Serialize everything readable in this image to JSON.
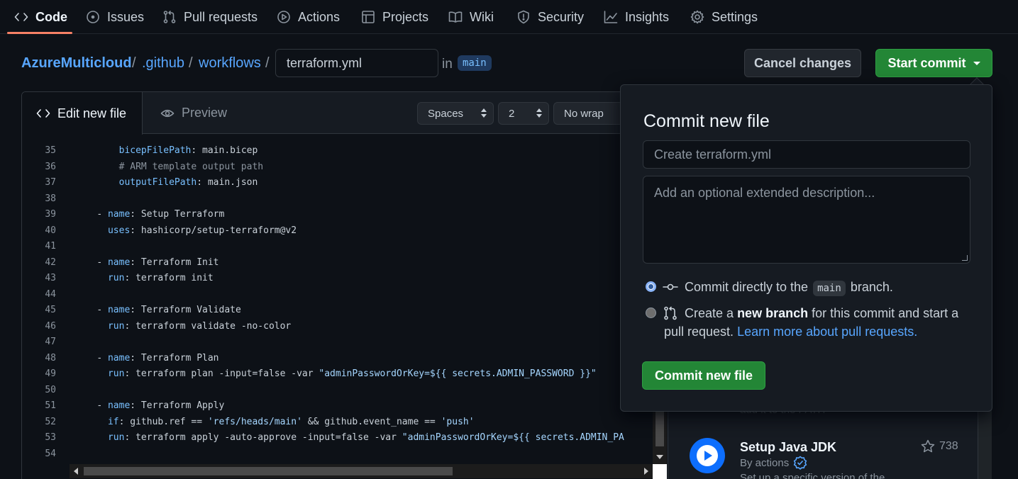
{
  "nav": {
    "tabs": [
      {
        "label": "Code",
        "icon": "code-icon"
      },
      {
        "label": "Issues",
        "icon": "issue-icon"
      },
      {
        "label": "Pull requests",
        "icon": "pull-request-icon"
      },
      {
        "label": "Actions",
        "icon": "play-icon"
      },
      {
        "label": "Projects",
        "icon": "table-icon"
      },
      {
        "label": "Wiki",
        "icon": "book-icon"
      },
      {
        "label": "Security",
        "icon": "shield-icon"
      },
      {
        "label": "Insights",
        "icon": "graph-icon"
      },
      {
        "label": "Settings",
        "icon": "gear-icon"
      }
    ],
    "selected": "Code"
  },
  "breadcrumb": {
    "repo": "AzureMulticloud",
    "sep": "/",
    "dir1": ".github",
    "dir2": "workflows",
    "filename": "terraform.yml",
    "in_text": "in",
    "branch": "main"
  },
  "header_buttons": {
    "cancel": "Cancel changes",
    "start_commit": "Start commit"
  },
  "editor": {
    "tabs": {
      "edit": "Edit new file",
      "preview": "Preview"
    },
    "indent_mode": "Spaces",
    "indent_size": "2",
    "wrap_mode": "No wrap",
    "lines": [
      {
        "n": "35",
        "i": "        ",
        "k": "bicepFilePath",
        "v": ": main.bicep"
      },
      {
        "n": "36",
        "i": "        ",
        "c": "# ARM template output path"
      },
      {
        "n": "37",
        "i": "        ",
        "k": "outputFilePath",
        "v": ": main.json"
      },
      {
        "n": "38",
        "i": ""
      },
      {
        "n": "39",
        "i": "    ",
        "d": "- ",
        "k": "name",
        "v": ": Setup Terraform"
      },
      {
        "n": "40",
        "i": "      ",
        "k": "uses",
        "v": ": hashicorp/setup-terraform@v2"
      },
      {
        "n": "41",
        "i": ""
      },
      {
        "n": "42",
        "i": "    ",
        "d": "- ",
        "k": "name",
        "v": ": Terraform Init"
      },
      {
        "n": "43",
        "i": "      ",
        "k": "run",
        "v": ": terraform init"
      },
      {
        "n": "44",
        "i": ""
      },
      {
        "n": "45",
        "i": "    ",
        "d": "- ",
        "k": "name",
        "v": ": Terraform Validate"
      },
      {
        "n": "46",
        "i": "      ",
        "k": "run",
        "v": ": terraform validate -no-color"
      },
      {
        "n": "47",
        "i": ""
      },
      {
        "n": "48",
        "i": "    ",
        "d": "- ",
        "k": "name",
        "v": ": Terraform Plan"
      },
      {
        "n": "49",
        "i": "      ",
        "k": "run",
        "v": ": terraform plan -input=false -var ",
        "s": "\"adminPasswordOrKey=${{ secrets.ADMIN_PASSWORD }}\""
      },
      {
        "n": "50",
        "i": ""
      },
      {
        "n": "51",
        "i": "    ",
        "d": "- ",
        "k": "name",
        "v": ": Terraform Apply"
      },
      {
        "n": "52",
        "i": "      ",
        "k": "if",
        "v": ": github.ref == ",
        "s": "'refs/heads/main'",
        "v2": " && github.event_name == ",
        "s2": "'push'"
      },
      {
        "n": "53",
        "i": "      ",
        "k": "run",
        "v": ": terraform apply -auto-approve -input=false -var ",
        "s": "\"adminPasswordOrKey=${{ secrets.ADMIN_PA"
      },
      {
        "n": "54",
        "i": ""
      }
    ]
  },
  "commit_popover": {
    "title": "Commit new file",
    "summary_placeholder": "Create terraform.yml",
    "description_placeholder": "Add an optional extended description...",
    "option_direct": {
      "before": "Commit directly to the",
      "branch": "main",
      "after": "branch."
    },
    "option_new_branch": {
      "before": "Create a",
      "strong": "new branch",
      "after": "for this commit and start a",
      "line2": "pull request.",
      "link": "Learn more about pull requests."
    },
    "submit": "Commit new file"
  },
  "marketplace": {
    "faded_text": "add it to the PATH",
    "action_title": "Setup Java JDK",
    "action_by": "By actions",
    "stars": "738",
    "desc_partial": "Set up a specific version of the"
  },
  "colors": {
    "accent": "#238636",
    "link": "#58a6ff",
    "tab_underline": "#f78166",
    "background": "#0d1117"
  }
}
